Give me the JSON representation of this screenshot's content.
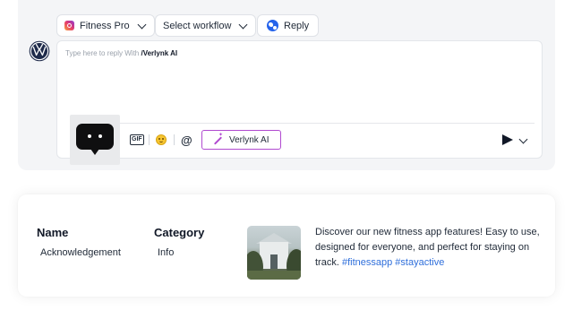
{
  "composer": {
    "account_label": "Fitness Pro",
    "workflow_label": "Select workflow",
    "mode_label": "Reply",
    "placeholder_prefix": "Type here to reply With ",
    "placeholder_ai": "/Verlynk AI",
    "toolbar": {
      "gif_label": "GIF",
      "mention_label": "@",
      "ai_button_label": "Verlynk AI"
    }
  },
  "post": {
    "name_header": "Name",
    "name_value": "Acknowledgement",
    "category_header": "Category",
    "category_value": "Info",
    "text": "Discover our new fitness app features! Easy to use, designed for everyone, and perfect for staying on track.",
    "hashtags": [
      "#fitnessapp",
      "#stayactive"
    ]
  },
  "colors": {
    "ai_accent": "#b04ad0",
    "hashtag": "#2f6fdb",
    "panel_bg": "#f4f5f7"
  },
  "icons": {
    "account": "instagram-icon",
    "mode": "globe-icon",
    "brand": "volkswagen-logo",
    "bot": "chatbot-icon",
    "emoji": "smiley-icon",
    "ai": "magic-wand-icon",
    "send": "send-icon"
  }
}
